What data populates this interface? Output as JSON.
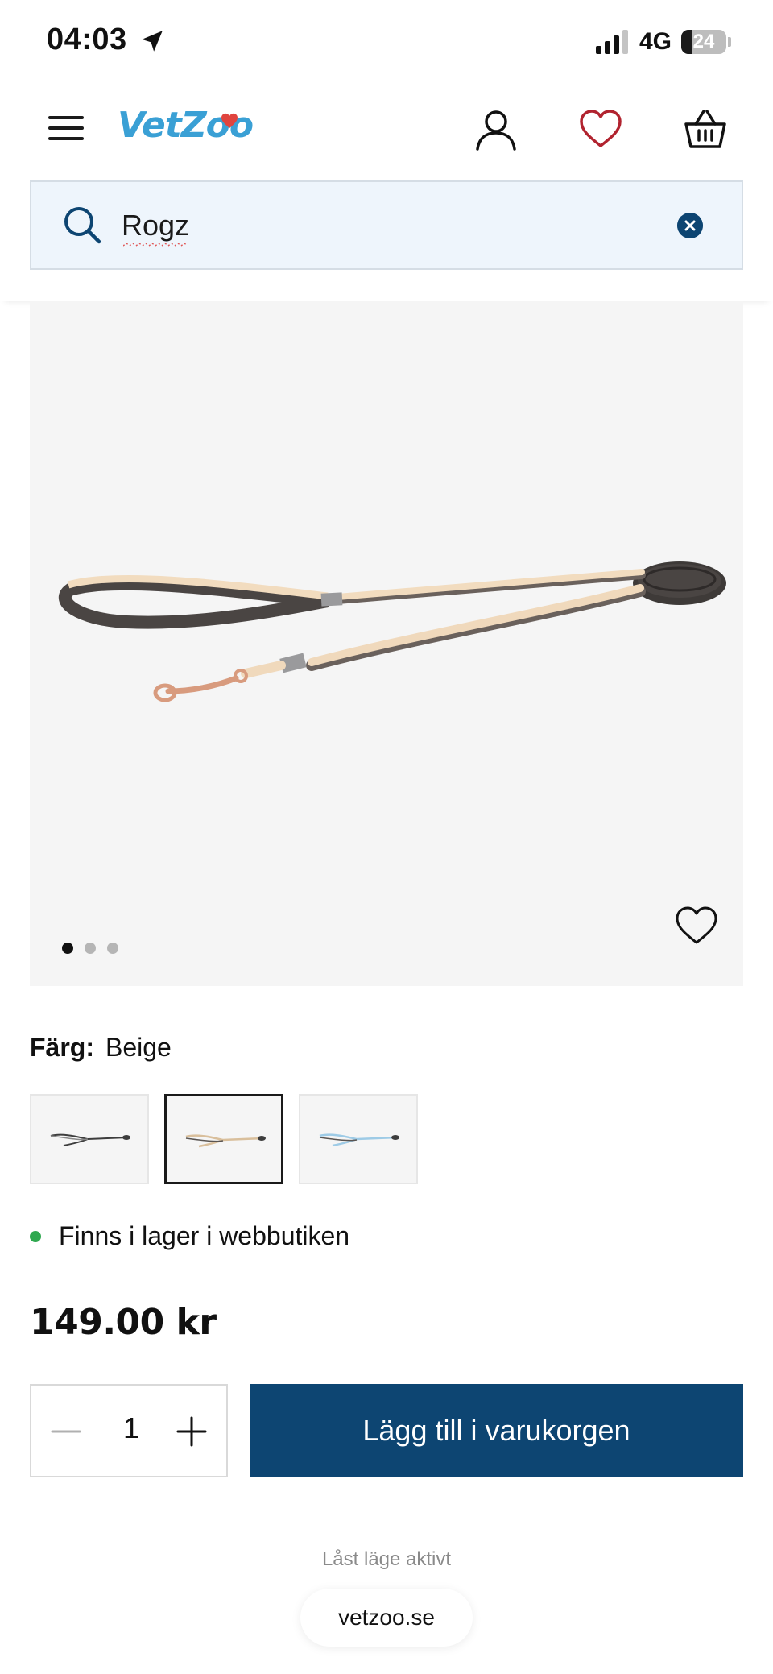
{
  "status_bar": {
    "time": "04:03",
    "network": "4G",
    "battery": "24",
    "battery_level": 0.24,
    "signal_bars": 3
  },
  "header": {
    "logo_text": "VetZoo",
    "brand_color": "#3aa0d5",
    "icons": [
      "menu-icon",
      "account-icon",
      "wishlist-heart-icon",
      "basket-icon"
    ]
  },
  "search": {
    "query": "Rogz",
    "placeholder": ""
  },
  "product": {
    "gallery": {
      "image_count": 3,
      "active_index": 0
    },
    "color": {
      "label": "Färg:",
      "value": "Beige",
      "options": [
        "black-leash",
        "beige-leash",
        "blue-leash"
      ],
      "selected_index": 1
    },
    "stock_text": "Finns i lager i webbutiken",
    "stock_color": "#2fa84f",
    "price": "149.00 kr",
    "quantity": "1",
    "add_to_cart_label": "Lägg till i varukorgen",
    "accent_color": "#0d4572"
  },
  "footer": {
    "lock_mode_text": "Låst läge aktivt",
    "url": "vetzoo.se"
  }
}
